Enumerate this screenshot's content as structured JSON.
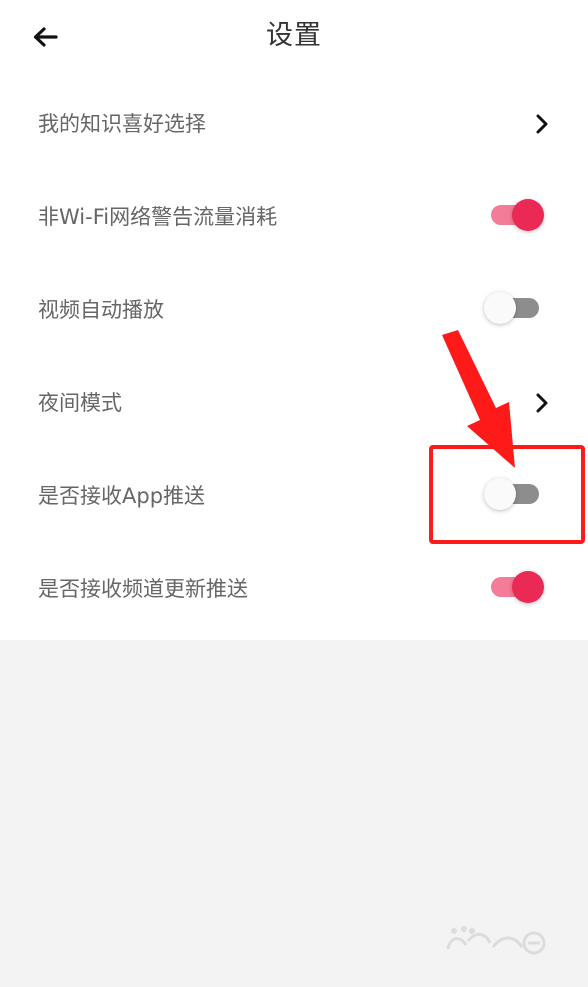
{
  "header": {
    "title": "设置"
  },
  "settings": {
    "items": [
      {
        "label": "我的知识喜好选择",
        "control": "chevron"
      },
      {
        "label": "非Wi-Fi网络警告流量消耗",
        "control": "toggle",
        "checked": true
      },
      {
        "label": "视频自动播放",
        "control": "toggle",
        "checked": false
      },
      {
        "label": "夜间模式",
        "control": "chevron"
      },
      {
        "label": "是否接收App推送",
        "control": "toggle",
        "checked": false
      },
      {
        "label": "是否接收频道更新推送",
        "control": "toggle",
        "checked": true
      }
    ]
  },
  "colors": {
    "accent": "#ea2a54",
    "accent_track": "#f57c98",
    "highlight": "#ff1a1a",
    "background": "#f3f3f3"
  },
  "icons": {
    "back": "back-arrow-icon",
    "chevron": "chevron-right-icon",
    "annotation": "red-arrow-annotation",
    "watermark": "baidu-watermark-icon"
  }
}
